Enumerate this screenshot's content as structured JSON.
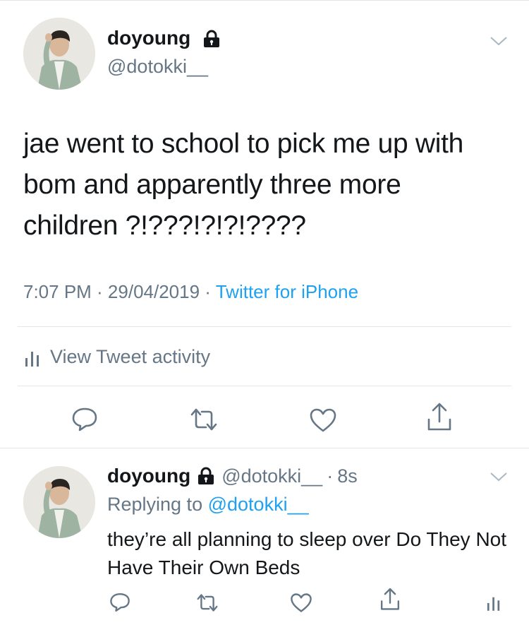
{
  "main_tweet": {
    "display_name": "doyoung",
    "handle": "@dotokki__",
    "text": "jae went to school to pick me up with bom and apparently three more children ?!???!?!?!????",
    "time_date": "7:07 PM · 29/04/2019",
    "source_sep": "·",
    "source": "Twitter for iPhone",
    "activity_label": "View Tweet activity"
  },
  "reply_tweet": {
    "display_name": "doyoung",
    "handle": "@dotokki__",
    "time_sep": "·",
    "time": "8s",
    "replying_prefix": "Replying to",
    "replying_to": "@dotokki__",
    "text": "they’re all planning to sleep over Do They Not Have Their Own Beds"
  },
  "icons": {
    "lock": "lock-icon",
    "chevron": "chevron-down-icon",
    "reply": "reply-icon",
    "retweet": "retweet-icon",
    "like": "like-icon",
    "share": "share-icon",
    "activity": "activity-icon"
  },
  "colors": {
    "accent": "#1da1f2",
    "text": "#14171a",
    "muted": "#657786",
    "divider": "#e1e8ed"
  }
}
